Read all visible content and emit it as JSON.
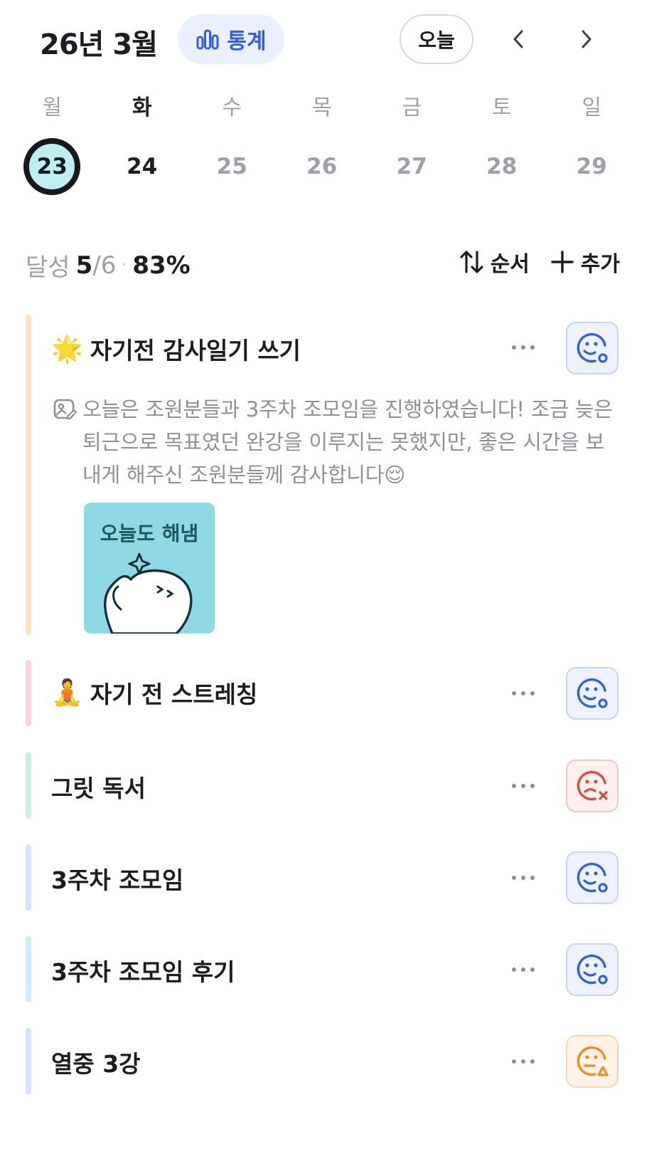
{
  "header": {
    "month_title": "26년 3월",
    "stats_label": "통계",
    "today_label": "오늘"
  },
  "week": {
    "days": [
      {
        "weekday": "월",
        "date": "23",
        "state": "selected"
      },
      {
        "weekday": "화",
        "date": "24",
        "state": "today"
      },
      {
        "weekday": "수",
        "date": "25",
        "state": "normal"
      },
      {
        "weekday": "목",
        "date": "26",
        "state": "normal"
      },
      {
        "weekday": "금",
        "date": "27",
        "state": "normal"
      },
      {
        "weekday": "토",
        "date": "28",
        "state": "normal"
      },
      {
        "weekday": "일",
        "date": "29",
        "state": "normal"
      }
    ]
  },
  "progress": {
    "label": "달성",
    "done": "5",
    "total": "/6",
    "separator": "·",
    "percent": "83%"
  },
  "actions": {
    "sort_label": "순서",
    "add_label": "추가"
  },
  "tasks": [
    {
      "emoji": "🌟",
      "title": "자기전 감사일기 쓰기",
      "bar_color": "#fde3c4",
      "status": "success",
      "note": "오늘은 조원분들과 3주차 조모임을 진행하였습니다! 조금 늦은 퇴근으로 목표였던 완강을 이루지는 못했지만, 좋은 시간을 보내게 해주신 조원분들께 감사합니다😌",
      "sticker_text": "오늘도 해냄"
    },
    {
      "emoji": "🧘",
      "title": "자기 전 스트레칭",
      "bar_color": "#fbd3e6",
      "status": "success"
    },
    {
      "emoji": "",
      "title": "그릿 독서",
      "bar_color": "#c9f1dd",
      "status": "fail"
    },
    {
      "emoji": "",
      "title": "3주차 조모임",
      "bar_color": "#d6e3fb",
      "status": "success"
    },
    {
      "emoji": "",
      "title": "3주차 조모임 후기",
      "bar_color": "#cdeefb",
      "status": "success"
    },
    {
      "emoji": "",
      "title": "열중 3강",
      "bar_color": "#d6e3fb",
      "status": "partial"
    }
  ],
  "colors": {
    "accent_blue": "#2f5fe8",
    "fail_red": "#e5483b",
    "partial_orange": "#f08a1c",
    "selected_day_fill": "#bfeef0"
  },
  "icons": {
    "stats": "bar-chart-icon",
    "prev": "chevron-left-icon",
    "next": "chevron-right-icon",
    "sort": "sort-arrows-icon",
    "add": "plus-icon",
    "more": "more-dots-icon",
    "note": "image-note-icon"
  }
}
